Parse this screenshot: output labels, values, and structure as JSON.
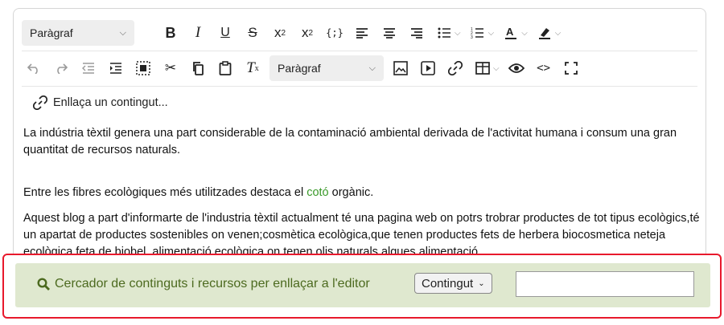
{
  "toolbar": {
    "paragraph_select_1": "Paràgraf",
    "paragraph_select_2": "Paràgraf",
    "link_content_label": "Enllaça un contingut..."
  },
  "content": {
    "paragraph_1": "La indústria tèxtil genera una part considerable de la contaminació ambiental derivada de l'activitat humana i consum una gran quantitat de recursos naturals.",
    "paragraph_2_before": "Entre les fibres ecològiques més utilitzades destaca el ",
    "paragraph_2_link": "cotó",
    "paragraph_2_after": " orgànic.",
    "paragraph_3": "Aquest blog a part d'informarte de l'industria tèxtil actualment té una pagina web on potrs trobrar productes de tot tipus ecològics,té un apartat de productes sostenibles on venen;cosmètica ecològica,que tenen productes fets de herbera biocosmetica neteja ecològica feta de biobel, alimentació ecològica on tenen olis naturals algues alimentació"
  },
  "search": {
    "label": "Cercador de continguts i recursos per enllaçar a l'editor",
    "type_select": "Contingut",
    "input_value": ""
  },
  "colors": {
    "search_bg": "#dfe8cf",
    "search_text": "#4c6a1f",
    "highlight_border": "#e8192c",
    "link_green": "#3a9a2a"
  }
}
